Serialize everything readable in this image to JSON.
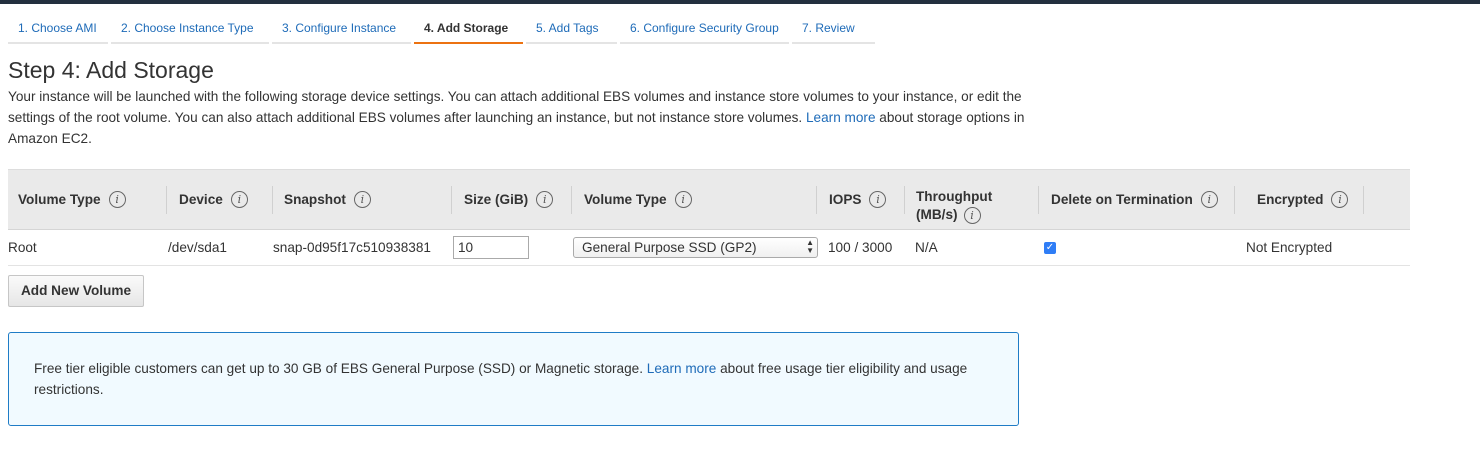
{
  "wizard": {
    "tabs": [
      {
        "label": "1. Choose AMI"
      },
      {
        "label": "2. Choose Instance Type"
      },
      {
        "label": "3. Configure Instance"
      },
      {
        "label": "4. Add Storage",
        "active": true
      },
      {
        "label": "5. Add Tags"
      },
      {
        "label": "6. Configure Security Group"
      },
      {
        "label": "7. Review"
      }
    ]
  },
  "page": {
    "title": "Step 4: Add Storage",
    "description_before_link": "Your instance will be launched with the following storage device settings. You can attach additional EBS volumes and instance store volumes to your instance, or edit the settings of the root volume. You can also attach additional EBS volumes after launching an instance, but not instance store volumes.",
    "description_link": "Learn more",
    "description_after_link": "about storage options in Amazon EC2."
  },
  "table": {
    "columns": [
      {
        "label": "Volume Type"
      },
      {
        "label": "Device"
      },
      {
        "label": "Snapshot"
      },
      {
        "label": "Size (GiB)"
      },
      {
        "label": "Volume Type"
      },
      {
        "label": "IOPS"
      },
      {
        "label_line1": "Throughput",
        "label_line2": "(MB/s)"
      },
      {
        "label": "Delete on Termination"
      },
      {
        "label": "Encrypted"
      }
    ],
    "info_glyph": "i",
    "rows": [
      {
        "volume_type": "Root",
        "device": "/dev/sda1",
        "snapshot": "snap-0d95f17c510938381",
        "size": "10",
        "ebs_volume_type": "General Purpose SSD (GP2)",
        "iops": "100 / 3000",
        "throughput": "N/A",
        "delete_on_termination": true,
        "encrypted": "Not Encrypted"
      }
    ]
  },
  "buttons": {
    "add_new_volume": "Add New Volume"
  },
  "free_tier": {
    "text_before_link": "Free tier eligible customers can get up to 30 GB of EBS General Purpose (SSD) or Magnetic storage.",
    "link": "Learn more",
    "text_after_link": "about free usage tier eligibility and usage restrictions."
  },
  "colors": {
    "link": "#1e6bb8",
    "active_tab_underline": "#ec7211",
    "info_box_border": "#1f7cc6",
    "info_box_background": "#f1faff",
    "checkbox": "#2f7df6"
  },
  "icons": {
    "column_info": "info-circle-icon",
    "select_arrows": "updown-arrows-icon",
    "checkbox": "checkmark-icon"
  }
}
